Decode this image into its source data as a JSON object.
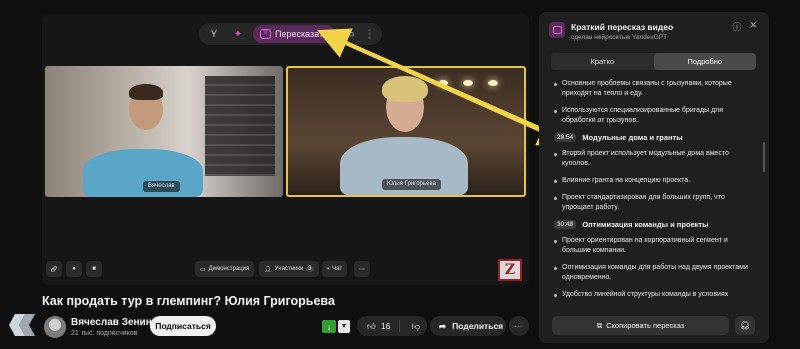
{
  "player": {
    "summarize_label": "Пересказать",
    "participants": [
      {
        "name": "Вячеслав"
      },
      {
        "name": "Юлия Григорьева"
      }
    ],
    "controls": {
      "demo_label": "Демонстрация",
      "participants_label": "Участники",
      "participants_count": "3",
      "chat_label": "Чат"
    }
  },
  "video": {
    "title": "Как продать тур в глемпинг? Юлия Григорьева",
    "channel_name": "Вячеслав Зенин",
    "subscribers": "21 тыс. подписчиков",
    "subscribe_label": "Подписаться",
    "like_count": "16",
    "share_label": "Поделиться"
  },
  "panel": {
    "title": "Краткий пересказ видео",
    "subtitle": "сделан нейросетью YandexGPT",
    "tabs": [
      {
        "label": "Кратко",
        "active": false
      },
      {
        "label": "Подробно",
        "active": true
      }
    ],
    "blocks": [
      {
        "type": "item",
        "text": "Основные проблемы связаны с грызунами, которые приходят на тепло и еду."
      },
      {
        "type": "item",
        "text": "Используются специализированные бригады для обработки от грызунов."
      },
      {
        "type": "section",
        "time": "28:54",
        "title": "Модульные дома и гранты"
      },
      {
        "type": "item",
        "text": "Второй проект использует модульные дома вместо куполов."
      },
      {
        "type": "item",
        "text": "Влияние гранта на концепцию проекта."
      },
      {
        "type": "item",
        "text": "Проект стандартизирован для больших групп, что упрощает работу."
      },
      {
        "type": "section",
        "time": "30:48",
        "title": "Оптимизация команды и проекты"
      },
      {
        "type": "item",
        "text": "Проект ориентирован на корпоративный сегмент и большие компании."
      },
      {
        "type": "item",
        "text": "Оптимизация команды для работы над двумя проектами одновременно."
      },
      {
        "type": "item",
        "text": "Удобство линейной структуры команды в условиях"
      }
    ],
    "copy_label": "Скопировать пересказ"
  },
  "colors": {
    "accent": "#e56ad0",
    "arrow": "#f2d34a",
    "highlight_border": "#e5c53b"
  }
}
